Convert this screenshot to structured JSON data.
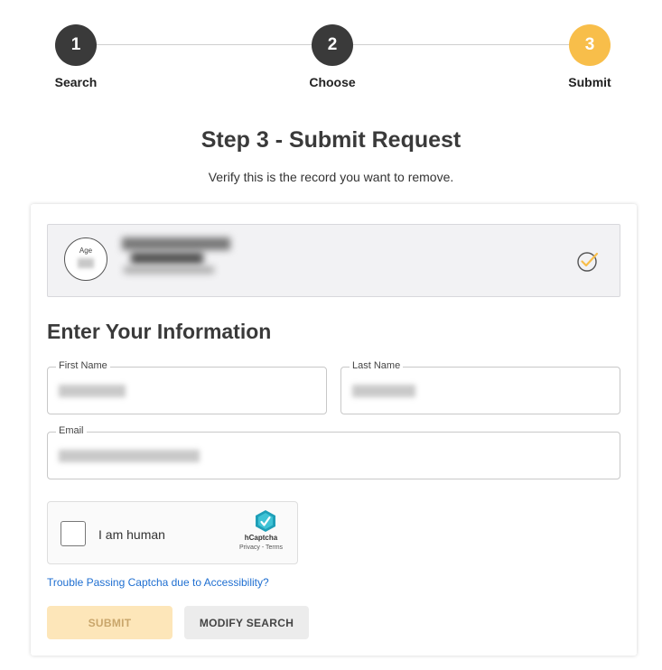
{
  "stepper": {
    "steps": [
      {
        "number": "1",
        "label": "Search"
      },
      {
        "number": "2",
        "label": "Choose"
      },
      {
        "number": "3",
        "label": "Submit"
      }
    ]
  },
  "header": {
    "title": "Step 3 - Submit Request",
    "subtitle": "Verify this is the record you want to remove."
  },
  "record": {
    "age_label": "Age"
  },
  "form": {
    "section_title": "Enter Your Information",
    "first_name_label": "First Name",
    "last_name_label": "Last Name",
    "email_label": "Email"
  },
  "captcha": {
    "label": "I am human",
    "brand": "hCaptcha",
    "links": "Privacy - Terms"
  },
  "help_link": "Trouble Passing Captcha due to Accessibility?",
  "buttons": {
    "submit": "SUBMIT",
    "modify": "MODIFY SEARCH"
  },
  "colors": {
    "accent": "#f8be4a",
    "step_done": "#3a3a3a",
    "link": "#1f6fd1"
  }
}
